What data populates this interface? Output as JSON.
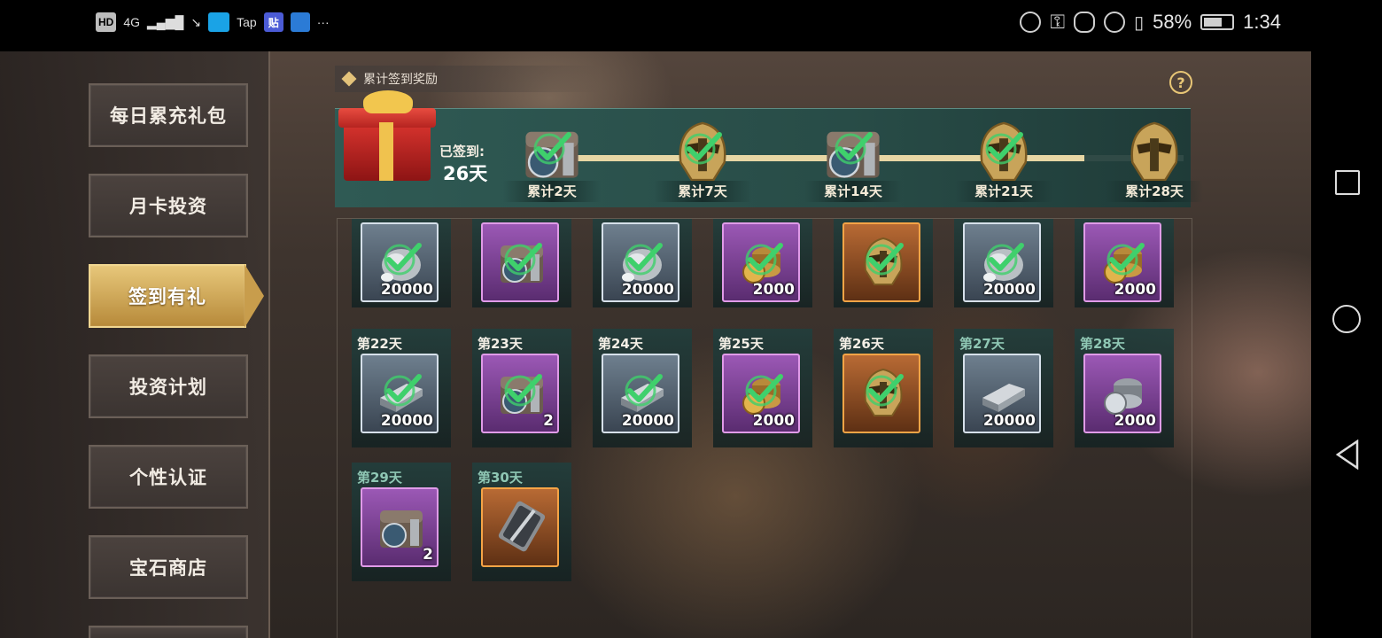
{
  "status_bar": {
    "chips": [
      "HD",
      "4G",
      "Tap"
    ],
    "more": "···",
    "battery_pct": "58%",
    "time": "1:34",
    "battery_level": 0.58
  },
  "sidebar": {
    "items": [
      {
        "label": "每日累充礼包",
        "active": false
      },
      {
        "label": "月卡投资",
        "active": false
      },
      {
        "label": "签到有礼",
        "active": true
      },
      {
        "label": "投资计划",
        "active": false
      },
      {
        "label": "个性认证",
        "active": false
      },
      {
        "label": "宝石商店",
        "active": false
      }
    ]
  },
  "panel": {
    "title": "累计签到奖励",
    "help": "?",
    "signed_label": "已签到:",
    "signed_days": "26天",
    "milestones": [
      {
        "label": "累计2天",
        "icon": "chest-icon",
        "claimed": true
      },
      {
        "label": "累计7天",
        "icon": "helmet-icon",
        "claimed": true
      },
      {
        "label": "累计14天",
        "icon": "chest-icon",
        "claimed": true
      },
      {
        "label": "累计21天",
        "icon": "helmet-icon",
        "claimed": true
      },
      {
        "label": "累计28天",
        "icon": "helmet-icon",
        "claimed": false
      }
    ],
    "top_row": [
      {
        "qty": "20000",
        "rarity": "white",
        "icon": "stone-icon",
        "claimed": true
      },
      {
        "qty": "",
        "rarity": "purple",
        "icon": "chest-icon",
        "claimed": true
      },
      {
        "qty": "20000",
        "rarity": "white",
        "icon": "stone-icon",
        "claimed": true
      },
      {
        "qty": "2000",
        "rarity": "purple",
        "icon": "coins-icon",
        "claimed": true
      },
      {
        "qty": "",
        "rarity": "orange",
        "icon": "helmet-icon",
        "claimed": true
      },
      {
        "qty": "20000",
        "rarity": "white",
        "icon": "stone-icon",
        "claimed": true
      },
      {
        "qty": "2000",
        "rarity": "purple",
        "icon": "coins-icon",
        "claimed": true
      }
    ],
    "days": [
      {
        "day": "第22天",
        "qty": "20000",
        "rarity": "white",
        "icon": "iron-ingot-icon",
        "claimed": true
      },
      {
        "day": "第23天",
        "qty": "2",
        "rarity": "purple",
        "icon": "chest-icon",
        "claimed": true
      },
      {
        "day": "第24天",
        "qty": "20000",
        "rarity": "white",
        "icon": "iron-ingot-icon",
        "claimed": true
      },
      {
        "day": "第25天",
        "qty": "2000",
        "rarity": "purple",
        "icon": "coins-icon",
        "claimed": true
      },
      {
        "day": "第26天",
        "qty": "",
        "rarity": "orange",
        "icon": "helmet-icon",
        "claimed": true
      },
      {
        "day": "第27天",
        "qty": "20000",
        "rarity": "white",
        "icon": "iron-ingot-icon",
        "claimed": false
      },
      {
        "day": "第28天",
        "qty": "2000",
        "rarity": "purple",
        "icon": "silver-coins-icon",
        "claimed": false
      },
      {
        "day": "第29天",
        "qty": "2",
        "rarity": "purple",
        "icon": "chest-icon",
        "claimed": false
      },
      {
        "day": "第30天",
        "qty": "",
        "rarity": "orange",
        "icon": "card-icon",
        "claimed": false
      }
    ]
  },
  "colors": {
    "accent_gold": "#e3c27a",
    "check_green": "#3fd06c",
    "panel_teal": "#2f5a54"
  }
}
